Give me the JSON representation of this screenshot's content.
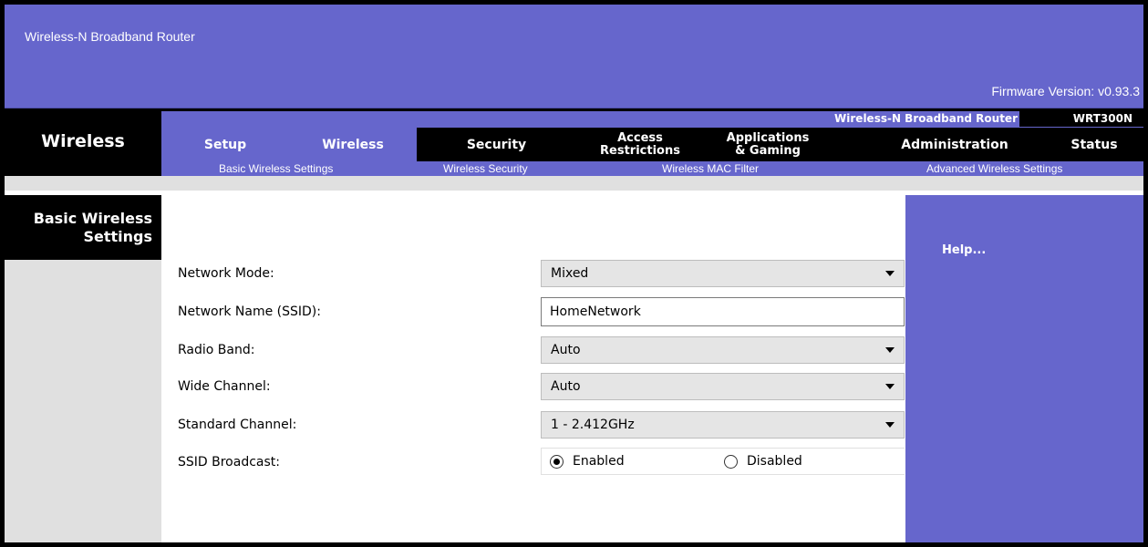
{
  "banner": {
    "title": "Wireless-N Broadband Router",
    "firmware": "Firmware Version: v0.93.3"
  },
  "nav": {
    "section": "Wireless",
    "product_name": "Wireless-N Broadband Router",
    "model": "WRT300N",
    "tabs": {
      "setup": "Setup",
      "wireless": "Wireless",
      "security": "Security",
      "access_line1": "Access",
      "access_line2": "Restrictions",
      "apps_line1": "Applications",
      "apps_line2": "& Gaming",
      "administration": "Administration",
      "status": "Status"
    },
    "subtabs": {
      "basic": "Basic Wireless Settings",
      "security": "Wireless Security",
      "mac": "Wireless MAC Filter",
      "advanced": "Advanced Wireless Settings"
    }
  },
  "page": {
    "heading_line1": "Basic Wireless",
    "heading_line2": "Settings",
    "help": "Help..."
  },
  "form": {
    "network_mode": {
      "label": "Network Mode:",
      "value": "Mixed"
    },
    "ssid": {
      "label": "Network Name (SSID):",
      "value": "HomeNetwork"
    },
    "radio_band": {
      "label": "Radio Band:",
      "value": "Auto"
    },
    "wide_channel": {
      "label": "Wide Channel:",
      "value": "Auto"
    },
    "standard_channel": {
      "label": "Standard Channel:",
      "value": "1 - 2.412GHz"
    },
    "ssid_broadcast": {
      "label": "SSID Broadcast:",
      "enabled": "Enabled",
      "disabled": "Disabled",
      "selected": "Enabled"
    }
  },
  "colors": {
    "brand_purple": "#6666cc",
    "nav_black": "#000000",
    "panel_gray": "#e0e0e0"
  }
}
